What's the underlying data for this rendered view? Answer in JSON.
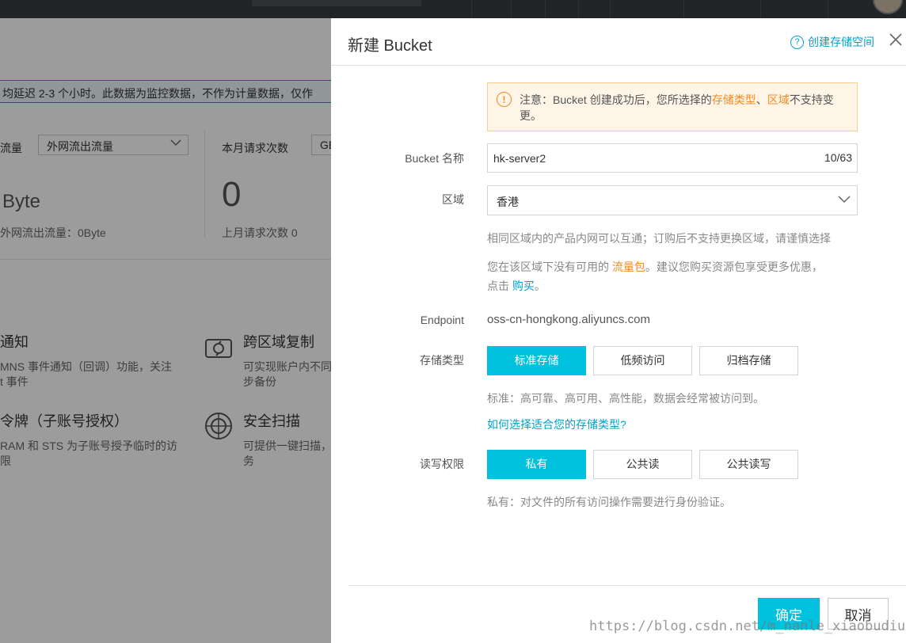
{
  "background": {
    "notice": "均延迟 2-3 个小时。此数据为监控数据，不作为计量数据，仅作",
    "traffic": {
      "label": "流量",
      "select": "外网流出流量",
      "value": "Byte",
      "sub": "外网流出流量：0Byte"
    },
    "requests": {
      "label": "本月请求次数",
      "select": "GE",
      "value": "0",
      "sub": "上月请求次数",
      "sub_value": "0"
    },
    "features": [
      {
        "title": "通知",
        "desc1": "MNS 事件通知（回调）功能，关注",
        "desc2": "t 事件"
      },
      {
        "title": "跨区域复制",
        "desc1": "可实现账户内不同",
        "desc2": "步备份"
      },
      {
        "title": "令牌（子账号授权）",
        "desc1": "RAM 和 STS 为子账号授予临时的访",
        "desc2": "限"
      },
      {
        "title": "安全扫描",
        "desc1": "可提供一键扫描，",
        "desc2": "务"
      }
    ]
  },
  "drawer": {
    "title": "新建 Bucket",
    "help_link": "创建存储空间",
    "warning": {
      "prefix": "注意：Bucket 创建成功后，您所选择的",
      "storage_type": "存储类型",
      "sep": "、",
      "region": "区域",
      "suffix": "不支持变更。"
    },
    "name": {
      "label": "Bucket 名称",
      "value": "hk-server2",
      "counter": "10/63"
    },
    "region": {
      "label": "区域",
      "selected": "香港",
      "hint": "相同区域内的产品内网可以互通；订购后不支持更换区域，请谨慎选择",
      "traffic_hint_prefix": "您在该区域下没有可用的",
      "traffic_pack": "流量包",
      "traffic_hint_mid": "。建议您购买资源包享受更多优惠，",
      "click": "点击",
      "buy": "购买",
      "period": "。"
    },
    "endpoint": {
      "label": "Endpoint",
      "value": "oss-cn-hongkong.aliyuncs.com"
    },
    "storage": {
      "label": "存储类型",
      "options": [
        "标准存储",
        "低频访问",
        "归档存储"
      ],
      "selected": "标准存储",
      "hint": "标准：高可靠、高可用、高性能，数据会经常被访问到。",
      "help_link": "如何选择适合您的存储类型?"
    },
    "acl": {
      "label": "读写权限",
      "options": [
        "私有",
        "公共读",
        "公共读写"
      ],
      "selected": "私有",
      "hint": "私有：对文件的所有访问操作需要进行身份验证。"
    },
    "buttons": {
      "ok": "确定",
      "cancel": "取消"
    }
  },
  "watermark": "https://blog.csdn.net/m_nanle_xiaobudiu",
  "colors": {
    "primary": "#00c1de",
    "link": "#00a2ca",
    "warning": "#f08a24",
    "warning_bg": "#fff5e6"
  }
}
